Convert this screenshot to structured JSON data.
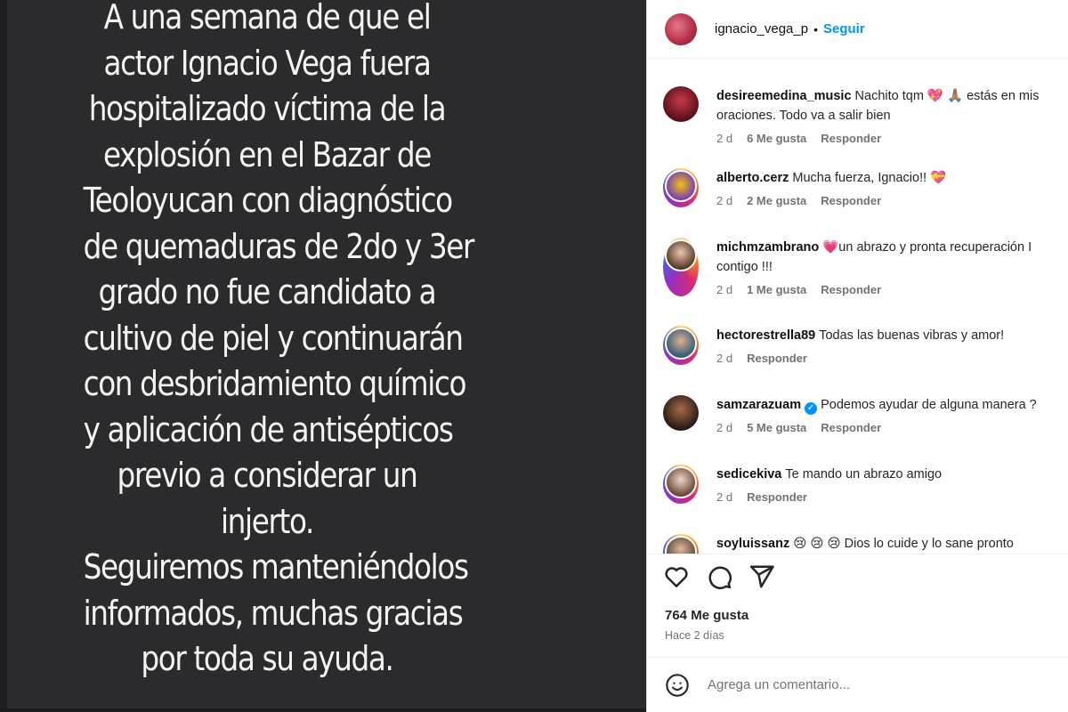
{
  "story": {
    "lines": [
      "A una semana de que el",
      "actor Ignacio Vega fuera",
      "hospitalizado víctima de la",
      "explosión en el Bazar de",
      "Teoloyucan con diagnóstico",
      "de quemaduras de 2do y 3er",
      "grado no fue candidato a",
      "cultivo de piel y continuarán",
      "con desbridamiento químico",
      "y aplicación de antisépticos",
      "previo a considerar un",
      "injerto.",
      "Seguiremos manteniéndolos",
      "informados, muchas gracias",
      "por toda su ayuda."
    ]
  },
  "header": {
    "username": "ignacio_vega_p",
    "separator": "•",
    "follow_label": "Seguir"
  },
  "comments": [
    {
      "username": "desireemedina_music",
      "text_line1": "Nachito tqm 💖 🙏🏽 estás en mis",
      "text_line2": "oraciones. Todo va a salir bien",
      "time": "2 d",
      "likes": "6 Me gusta",
      "reply": "Responder"
    },
    {
      "username": "alberto.cerz",
      "text_line1": "Mucha fuerza, Ignacio!! 💝",
      "time": "2 d",
      "likes": "2 Me gusta",
      "reply": "Responder"
    },
    {
      "username": "michmzambrano",
      "text_line1": "💗un abrazo y pronta recuperación I",
      "text_line2": "contigo !!!",
      "time": "2 d",
      "likes": "1 Me gusta",
      "reply": "Responder"
    },
    {
      "username": "hectorestrella89",
      "text_line1": "Todas las buenas vibras y amor!",
      "time": "2 d",
      "reply": "Responder"
    },
    {
      "username": "samzarazuam",
      "text_line1": "Podemos ayudar de alguna manera ?",
      "time": "2 d",
      "likes": "5 Me gusta",
      "reply": "Responder"
    },
    {
      "username": "sedicekiva",
      "text_line1": "Te mando un abrazo amigo",
      "time": "2 d",
      "reply": "Responder"
    },
    {
      "username": "soyluissanz",
      "text_line1": "😢 😢 😢 Dios lo cuide y lo sane pronto"
    }
  ],
  "actions": {
    "like_icon": "heart-icon",
    "comment_icon": "comment-icon",
    "share_icon": "share-icon",
    "likes_count": "764 Me gusta",
    "time_ago": "Hace 2 días"
  },
  "add_comment": {
    "emoji_icon": "smiley-icon",
    "placeholder": "Agrega un comentario..."
  },
  "colors": {
    "story_background": "#2b2b2d",
    "story_text": "#f4f4f4",
    "accent": "#0095f6",
    "secondary_text": "#737373"
  }
}
